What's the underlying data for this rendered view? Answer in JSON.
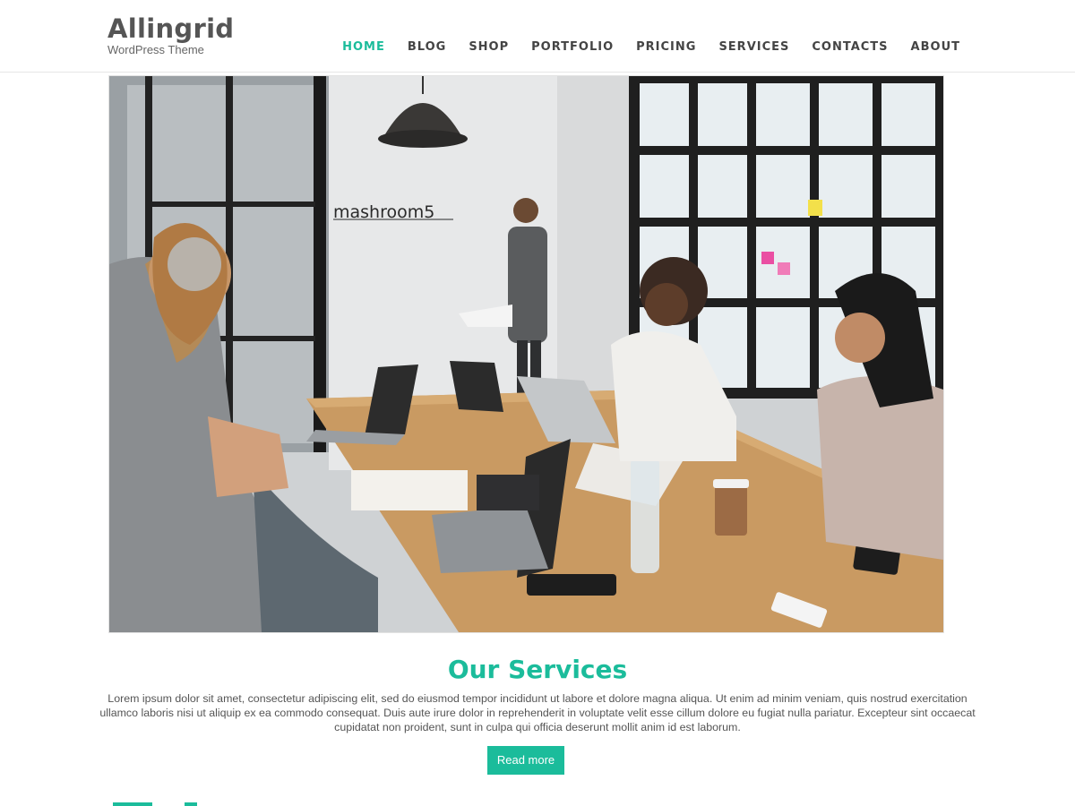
{
  "header": {
    "site_title": "Allingrid",
    "site_description": "WordPress Theme"
  },
  "nav": {
    "items": [
      {
        "label": "HOME",
        "active": true
      },
      {
        "label": "BLOG"
      },
      {
        "label": "SHOP"
      },
      {
        "label": "PORTFOLIO"
      },
      {
        "label": "PRICING"
      },
      {
        "label": "SERVICES"
      },
      {
        "label": "CONTACTS"
      },
      {
        "label": "ABOUT"
      }
    ]
  },
  "hero": {
    "wall_sign": "mashroom5"
  },
  "services": {
    "title": "Our Services",
    "text": "Lorem ipsum dolor sit amet, consectetur adipiscing elit, sed do eiusmod tempor incididunt ut labore et dolore magna aliqua. Ut enim ad minim veniam, quis nostrud exercitation ullamco laboris nisi ut aliquip ex ea commodo consequat. Duis aute irure dolor in reprehenderit in voluptate velit esse cillum dolore eu fugiat nulla pariatur. Excepteur sint occaecat cupidatat non proident, sunt in culpa qui officia deserunt mollit anim id est laborum.",
    "button_label": "Read more"
  },
  "colors": {
    "accent": "#1bbc9b",
    "text": "#555555"
  }
}
